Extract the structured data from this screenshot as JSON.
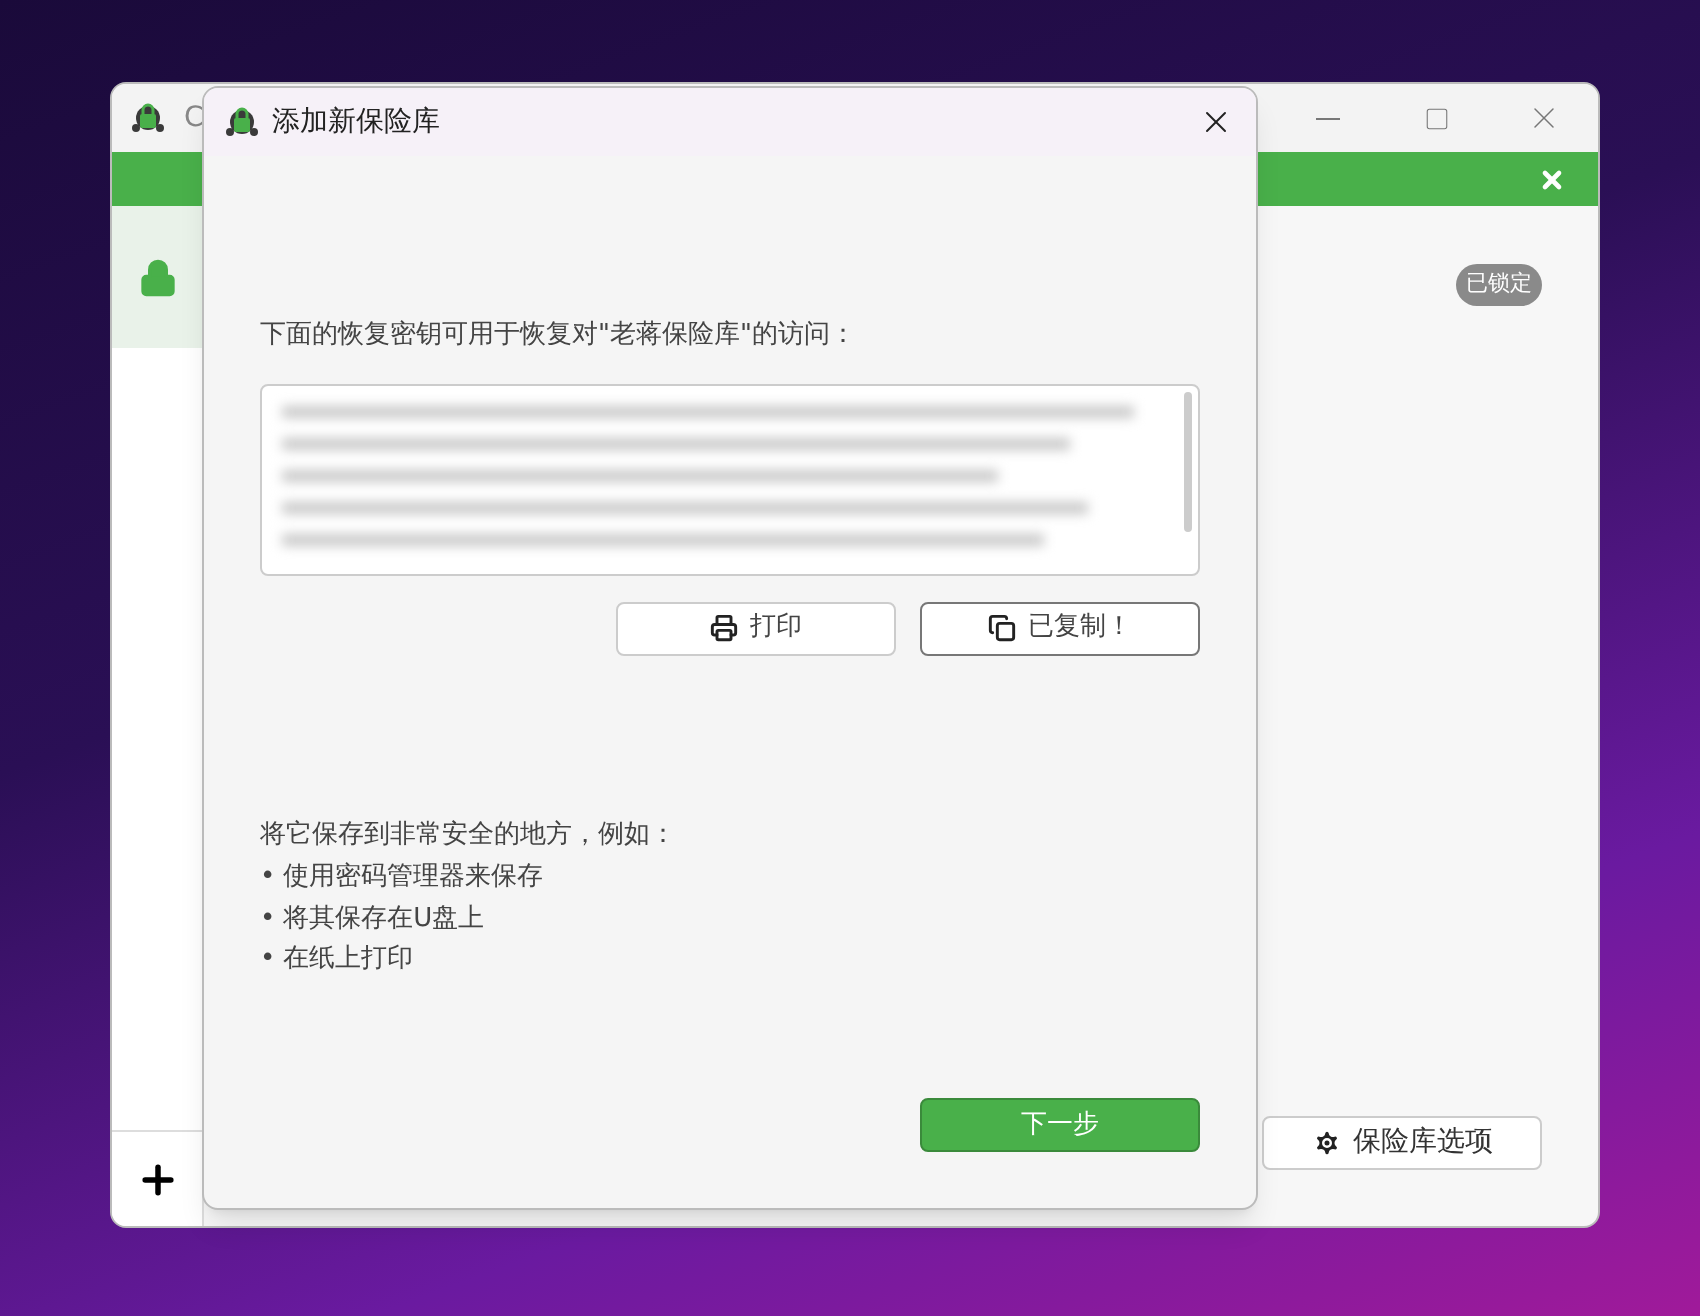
{
  "main_window": {
    "title": "C",
    "sidebar": {
      "items": [
        {
          "selected": true
        }
      ]
    },
    "status_badge": "已锁定",
    "options_button": "保险库选项"
  },
  "dialog": {
    "title": "添加新保险库",
    "prompt": "下面的恢复密钥可用于恢复对\"老蒋保险库\"的访问：",
    "buttons": [
      {
        "label": "打印",
        "kind": "print"
      },
      {
        "label": "已复制！",
        "kind": "copy"
      }
    ],
    "hint": "将它保存到非常安全的地方，例如：",
    "tips": [
      {
        "bullet": "•",
        "text": "使用密码管理器来保存"
      },
      {
        "bullet": "•",
        "text": "将其保存在U盘上"
      },
      {
        "bullet": "•",
        "text": "在纸上打印"
      }
    ],
    "next_button": "下一步"
  }
}
